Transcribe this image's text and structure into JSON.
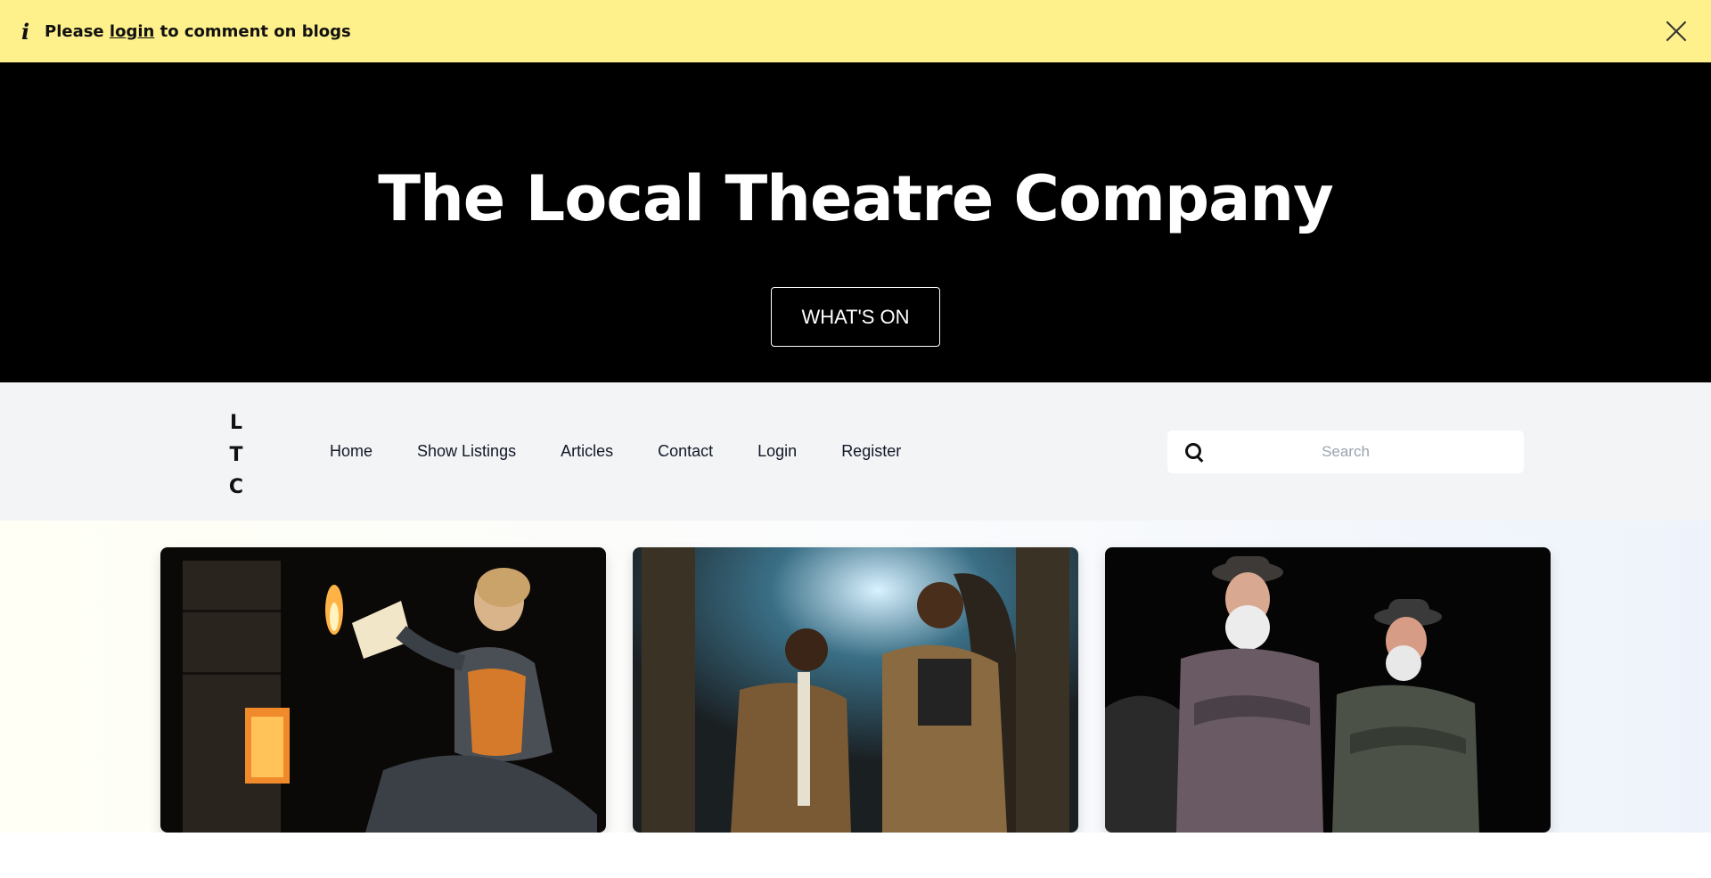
{
  "notice": {
    "icon": "info-icon",
    "prefix": "Please",
    "link": "login",
    "suffix": "to comment on blogs",
    "background": "#fef08a"
  },
  "hero": {
    "title": "The Local Theatre Company",
    "cta_label": "WHAT'S ON"
  },
  "nav": {
    "logo": [
      "L",
      "T",
      "C"
    ],
    "items": [
      "Home",
      "Show Listings",
      "Articles",
      "Contact",
      "Login",
      "Register"
    ],
    "search": {
      "placeholder": "Search",
      "icon": "search-icon"
    }
  },
  "gallery": {
    "images": [
      "theatre-photo-woman-burning-letter",
      "theatre-photo-two-men-talking",
      "theatre-photo-two-old-men-in-bowler-hats"
    ]
  }
}
